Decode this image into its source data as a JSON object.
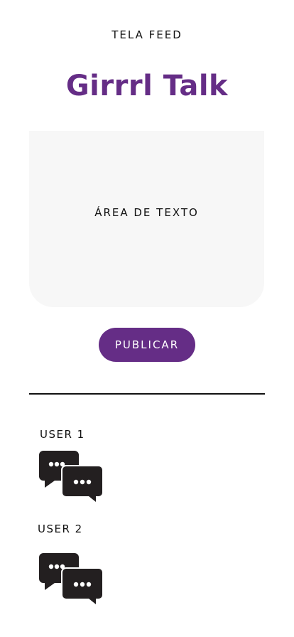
{
  "screen": {
    "title": "TELA FEED"
  },
  "app": {
    "title": "Girrrl Talk",
    "accent_color": "#652d86"
  },
  "post": {
    "text_area_placeholder": "ÁREA DE TEXTO",
    "publish_label": "PUBLICAR"
  },
  "feed": {
    "users": [
      {
        "label": "USER 1",
        "icon": "chat-bubbles-icon"
      },
      {
        "label": "USER 2",
        "icon": "chat-bubbles-icon"
      }
    ]
  }
}
